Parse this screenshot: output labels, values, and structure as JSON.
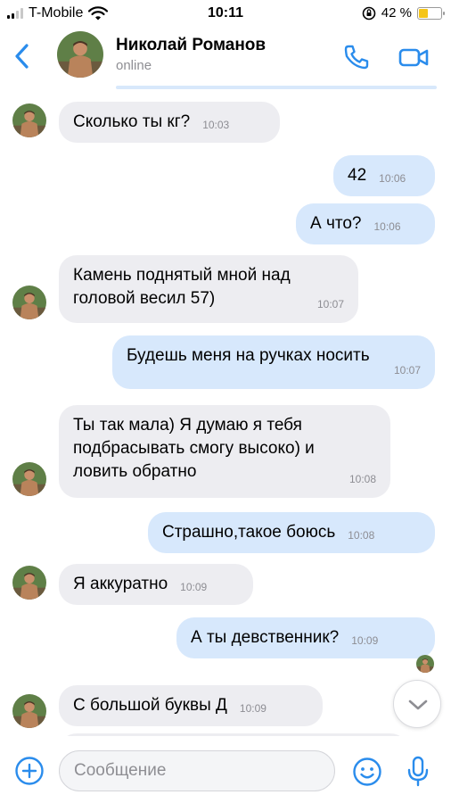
{
  "status_bar": {
    "carrier": "T-Mobile",
    "time": "10:11",
    "battery_percent": "42 %"
  },
  "header": {
    "contact_name": "Николай Романов",
    "contact_status": "online"
  },
  "messages": [
    {
      "direction": "in",
      "text": "Сколько ты кг?",
      "time": "10:03"
    },
    {
      "direction": "out",
      "text": "42",
      "time": "10:06"
    },
    {
      "direction": "out",
      "text": "А что?",
      "time": "10:06"
    },
    {
      "direction": "in",
      "text": "Камень поднятый мной над\nголовой весил 57)",
      "time": "10:07"
    },
    {
      "direction": "out",
      "text": "Будешь меня на ручках носить",
      "time": "10:07"
    },
    {
      "direction": "in",
      "text": "Ты так мала) Я думаю я тебя\nподбрасывать смогу высоко) и\nловить обратно",
      "time": "10:08"
    },
    {
      "direction": "out",
      "text": "Страшно,такое боюсь",
      "time": "10:08"
    },
    {
      "direction": "in",
      "text": "Я аккуратно",
      "time": "10:09"
    },
    {
      "direction": "out",
      "text": "А ты девственник?",
      "time": "10:09"
    },
    {
      "direction": "in",
      "text": "С большой буквы Д",
      "time": "10:09"
    }
  ],
  "composer": {
    "placeholder": "Сообщение"
  },
  "colors": {
    "accent": "#2a8cec",
    "incoming_bubble": "#ededf1",
    "outgoing_bubble": "#d7e8fc"
  },
  "icons": [
    "back-chevron-icon",
    "phone-icon",
    "video-camera-icon",
    "chevron-down-icon",
    "plus-circle-icon",
    "smile-icon",
    "microphone-icon"
  ]
}
